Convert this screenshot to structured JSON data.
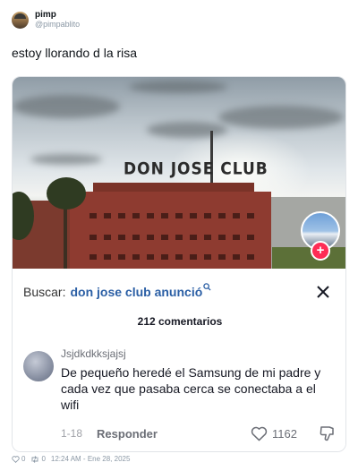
{
  "post": {
    "display_name": "pimp",
    "handle": "@pimpablito",
    "text": "estoy llorando d la risa",
    "footer": {
      "likes": "0",
      "reposts": "0",
      "timestamp": "12:24 AM - Ene 28, 2025"
    }
  },
  "media": {
    "sign_text": "DON JOSE CLUB",
    "search_prefix": "Buscar:",
    "search_query": "don jose club anunció",
    "comments_count": "212 comentarios",
    "comment": {
      "username": "Jsjdkdkksjajsj",
      "text": "De pequeño heredé el Samsung de mi padre y cada vez que pasaba cerca se conectaba a el wifi",
      "date": "1-18",
      "reply_label": "Responder",
      "likes": "1162"
    }
  },
  "icons": [
    "heart-icon",
    "repost-icon",
    "search-icon",
    "close-icon",
    "thumbs-down-icon",
    "plus-icon"
  ],
  "colors": {
    "search_query": "#2b5fa5",
    "plus_badge": "#fe2c55",
    "text_primary": "#0f1419",
    "text_secondary": "#8b98a5"
  }
}
